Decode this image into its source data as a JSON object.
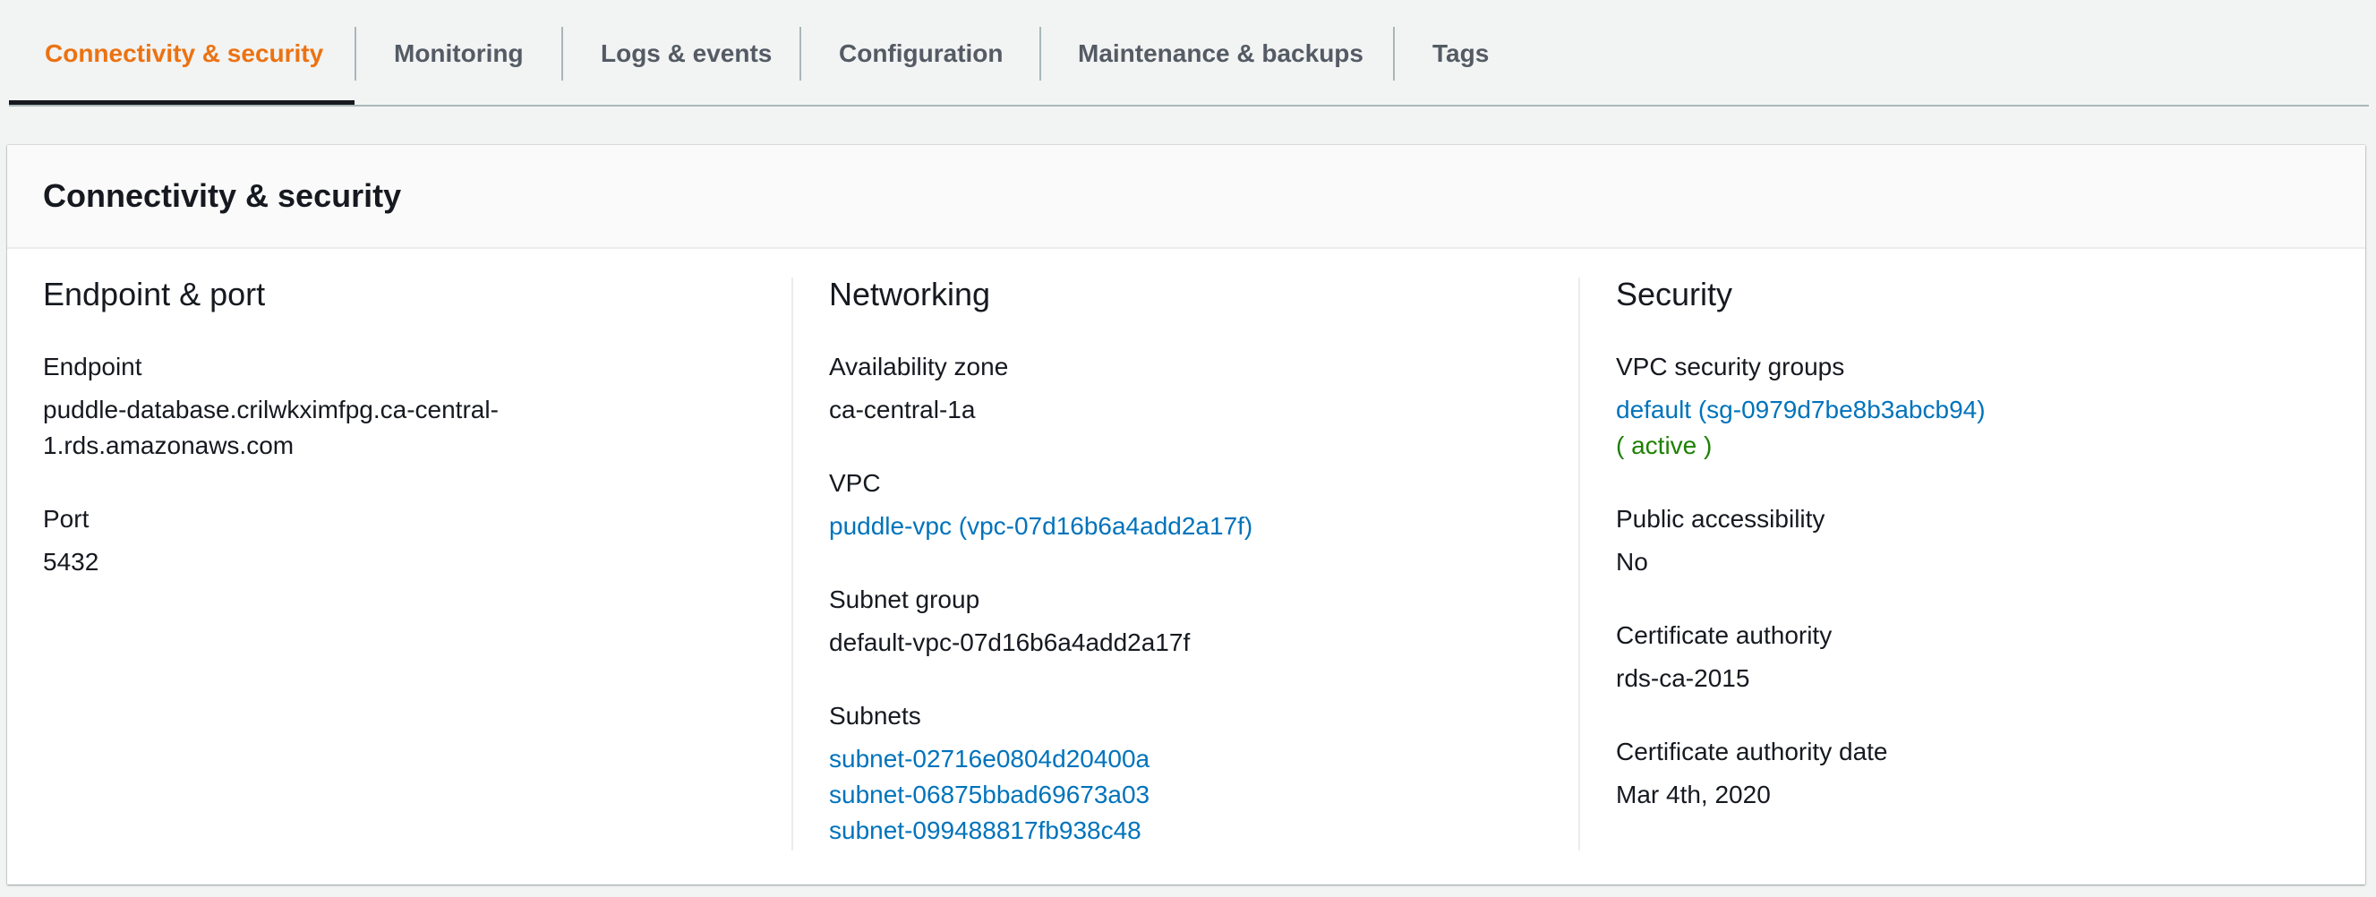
{
  "tabs": [
    {
      "label": "Connectivity & security",
      "active": true
    },
    {
      "label": "Monitoring",
      "active": false
    },
    {
      "label": "Logs & events",
      "active": false
    },
    {
      "label": "Configuration",
      "active": false
    },
    {
      "label": "Maintenance & backups",
      "active": false
    },
    {
      "label": "Tags",
      "active": false
    }
  ],
  "panel": {
    "title": "Connectivity & security"
  },
  "endpoint_port": {
    "title": "Endpoint & port",
    "endpoint_label": "Endpoint",
    "endpoint_value_line1": "puddle-database.crilwkximfpg.ca-central-",
    "endpoint_value_line2": "1.rds.amazonaws.com",
    "port_label": "Port",
    "port_value": "5432"
  },
  "networking": {
    "title": "Networking",
    "az_label": "Availability zone",
    "az_value": "ca-central-1a",
    "vpc_label": "VPC",
    "vpc_value": "puddle-vpc (vpc-07d16b6a4add2a17f)",
    "subnet_group_label": "Subnet group",
    "subnet_group_value": "default-vpc-07d16b6a4add2a17f",
    "subnets_label": "Subnets",
    "subnets": [
      "subnet-02716e0804d20400a",
      "subnet-06875bbad69673a03",
      "subnet-099488817fb938c48"
    ]
  },
  "security": {
    "title": "Security",
    "sg_label": "VPC security groups",
    "sg_value": "default (sg-0979d7be8b3abcb94)",
    "sg_status": "( active )",
    "public_label": "Public accessibility",
    "public_value": "No",
    "ca_label": "Certificate authority",
    "ca_value": "rds-ca-2015",
    "ca_date_label": "Certificate authority date",
    "ca_date_value": "Mar 4th, 2020"
  },
  "colors": {
    "accent_active_tab": "#ec7211",
    "link": "#0073bb",
    "status_active": "#1d8102"
  }
}
